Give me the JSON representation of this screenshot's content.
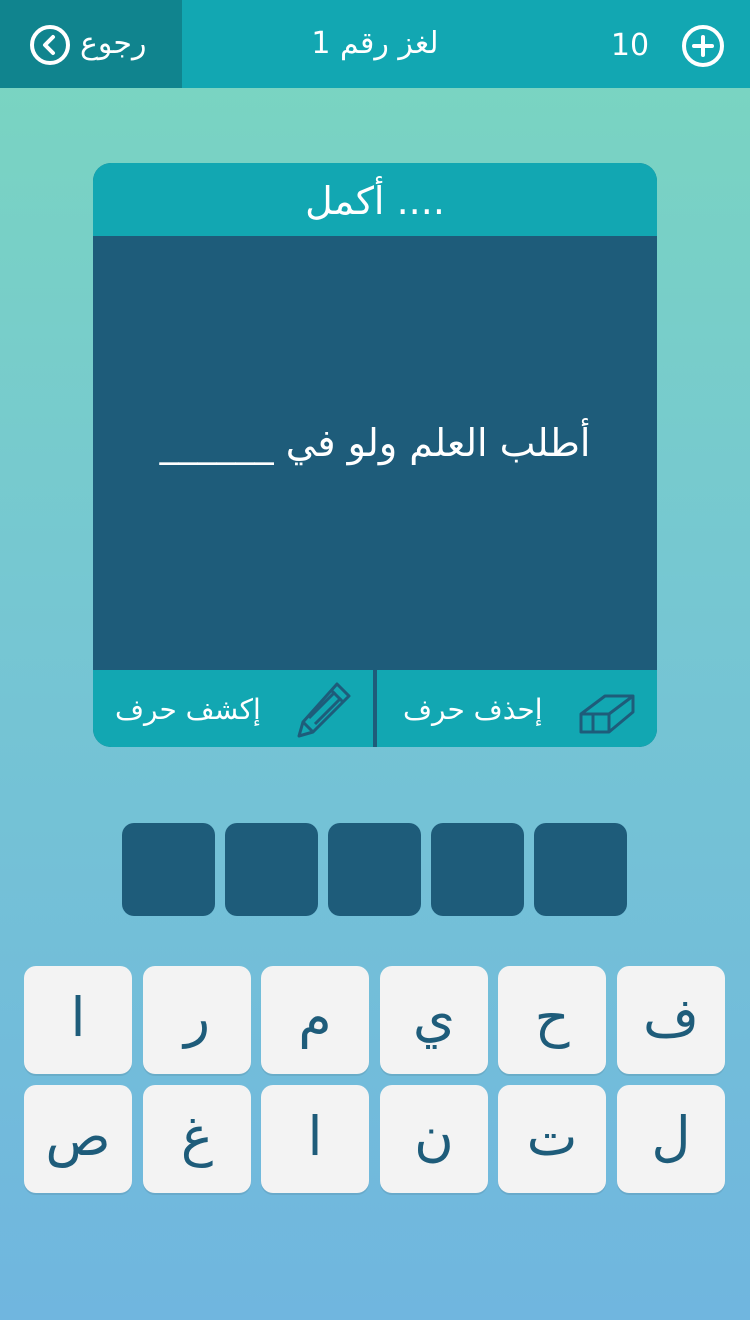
{
  "topbar": {
    "back_label": "رجوع",
    "title": "لغز رقم 1",
    "score": "10",
    "back_icon": "chevron-left-circle-icon",
    "add_icon": "plus-circle-icon"
  },
  "puzzle": {
    "header": "أكمل ....",
    "question": "أطلب العلم ولو في ______",
    "reveal_label": "إكشف حرف",
    "reveal_icon": "pencil-icon",
    "remove_label": "إحذف حرف",
    "remove_icon": "eraser-icon"
  },
  "answer": {
    "slot_count": 5,
    "slots": [
      "",
      "",
      "",
      "",
      ""
    ]
  },
  "keyboard": {
    "rows": [
      [
        "ف",
        "ح",
        "ي",
        "م",
        "ر",
        "ا"
      ],
      [
        "ل",
        "ت",
        "ن",
        "ا",
        "غ",
        "ص"
      ]
    ]
  },
  "colors": {
    "primary": "#12a7b2",
    "dark": "#1e5c7a",
    "back_bg": "#10848e",
    "key_bg": "#f3f3f3"
  }
}
